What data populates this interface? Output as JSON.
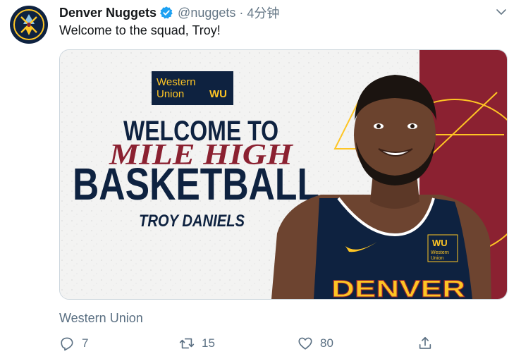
{
  "tweet": {
    "display_name": "Denver Nuggets",
    "handle": "@nuggets",
    "separator": "·",
    "timestamp": "4分钟",
    "text": "Welcome to the squad, Troy!",
    "verified": true,
    "avatar_icon": "denver-nuggets-logo-icon"
  },
  "media": {
    "sponsor_badge_line1": "Western",
    "sponsor_badge_line2": "Union",
    "sponsor_badge_wu": "WU",
    "headline_line1": "WELCOME TO",
    "headline_script": "MILE HIGH",
    "headline_line3": "BASKETBALL",
    "player_name": "TROY DANIELS",
    "jersey_text": "DENVER",
    "jersey_patch_wu": "WU",
    "jersey_patch_line1": "Western",
    "jersey_patch_line2": "Union",
    "colors": {
      "navy": "#0e2240",
      "gold": "#fec524",
      "red": "#8b2131"
    }
  },
  "promoted": {
    "label": "Western Union"
  },
  "actions": {
    "reply_count": "7",
    "retweet_count": "15",
    "like_count": "80",
    "icons": [
      "reply-icon",
      "retweet-icon",
      "like-icon",
      "share-icon"
    ]
  }
}
